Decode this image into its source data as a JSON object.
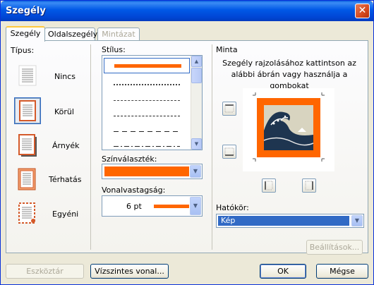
{
  "window": {
    "title": "Szegély",
    "close_symbol": "✕"
  },
  "tabs": [
    {
      "label": "Szegély",
      "state": "active"
    },
    {
      "label": "Oldalszegély",
      "state": "normal"
    },
    {
      "label": "Mintázat",
      "state": "disabled"
    }
  ],
  "setting": {
    "heading": "Típus:",
    "options": [
      {
        "label": "Nincs",
        "selected": false
      },
      {
        "label": "Körül",
        "selected": true
      },
      {
        "label": "Árnyék",
        "selected": false
      },
      {
        "label": "Térhatás",
        "selected": false
      },
      {
        "label": "Egyéni",
        "selected": false
      }
    ]
  },
  "style": {
    "heading": "Stílus:",
    "items": [
      "solid",
      "dotted",
      "dashed-fine",
      "dashed",
      "dash-long",
      "dash-dot"
    ]
  },
  "color": {
    "heading": "Színválaszték:",
    "value_color": "#ff6600"
  },
  "width": {
    "heading": "Vonalvastagság:",
    "value": "6 pt",
    "value_color": "#ff6600"
  },
  "preview": {
    "heading": "Minta",
    "hint": "Szegély rajzolásához kattintson az alábbi ábrán vagy használja a gombokat",
    "border_color": "#ff6600"
  },
  "apply_to": {
    "heading": "Hatókör:",
    "value": "Kép"
  },
  "buttons": {
    "options": "Beállítások...",
    "toolbar": "Eszköztár",
    "horizontal_line": "Vízszintes vonal...",
    "ok": "OK",
    "cancel": "Mégse"
  }
}
